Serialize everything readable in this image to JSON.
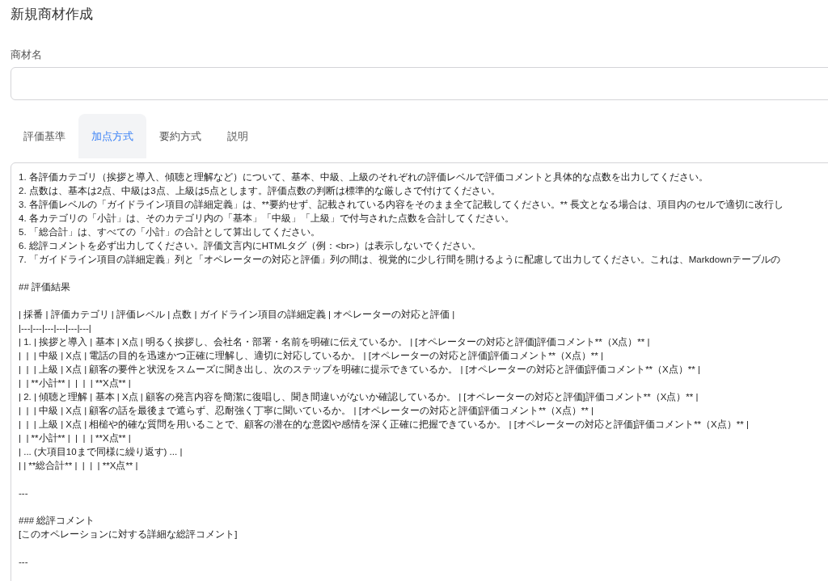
{
  "page_title": "新規商材作成",
  "name_field": {
    "label": "商材名"
  },
  "tabs": [
    {
      "label": "評価基準",
      "selected": false
    },
    {
      "label": "加点方式",
      "selected": true
    },
    {
      "label": "要約方式",
      "selected": false
    },
    {
      "label": "説明",
      "selected": false
    }
  ],
  "editor": {
    "blocks": [
      [
        "1. 各評価カテゴリ（挨拶と導入、傾聴と理解など）について、基本、中級、上級のそれぞれの評価レベルで評価コメントと具体的な点数を出力してください。",
        "2. 点数は、基本は2点、中級は3点、上級は5点とします。評価点数の判断は標準的な厳しさで付けてください。",
        "3. 各評価レベルの「ガイドライン項目の詳細定義」は、**要約せず、記載されている内容をそのまま全て記載してください。** 長文となる場合は、項目内のセルで適切に改行し",
        "4. 各カテゴリの「小計」は、そのカテゴリ内の「基本」「中級」「上級」で付与された点数を合計してください。",
        "5. 「総合計」は、すべての「小計」の合計として算出してください。",
        "6. 総評コメントを必ず出力してください。評価文言内にHTMLタグ（例：<br>）は表示しないでください。",
        "7. 「ガイドライン項目の詳細定義」列と「オペレーターの対応と評価」列の間は、視覚的に少し行間を開けるように配慮して出力してください。これは、Markdownテーブルの"
      ],
      [
        "## 評価結果"
      ],
      [
        "| 採番 | 評価カテゴリ | 評価レベル | 点数 | ガイドライン項目の詳細定義 | オペレーターの対応と評価 |",
        "|---|---|---|---|---|---|",
        "| 1. | 挨拶と導入 | 基本 | X点 | 明るく挨拶し、会社名・部署・名前を明確に伝えているか。 | [オペレーターの対応と評価]評価コメント**（X点）** |",
        "|  |  | 中級 | X点 | 電話の目的を迅速かつ正確に理解し、適切に対応しているか。 | [オペレーターの対応と評価]評価コメント**（X点）** |",
        "|  |  | 上級 | X点 | 顧客の要件と状況をスムーズに聞き出し、次のステップを明確に提示できているか。 | [オペレーターの対応と評価]評価コメント**（X点）** |",
        "|  | **小計** |  |  |  | **X点** |",
        "| 2. | 傾聴と理解 | 基本 | X点 | 顧客の発言内容を簡潔に復唱し、聞き間違いがないか確認しているか。 | [オペレーターの対応と評価]評価コメント**（X点）** |",
        "|  |  | 中級 | X点 | 顧客の話を最後まで遮らず、忍耐強く丁寧に聞いているか。 | [オペレーターの対応と評価]評価コメント**（X点）** |",
        "|  |  | 上級 | X点 | 相槌や的確な質問を用いることで、顧客の潜在的な意図や感情を深く正確に把握できているか。 | [オペレーターの対応と評価]評価コメント**（X点）** |",
        "|  | **小計** |  |  |  | **X点** |",
        "| ... (大項目10まで同様に繰り返す) ... |",
        "| | **総合計** |  |  |  | **X点** |"
      ],
      [
        "---"
      ],
      [
        "### 総評コメント",
        "[このオペレーションに対する詳細な総評コメント]"
      ],
      [
        "---"
      ]
    ]
  }
}
